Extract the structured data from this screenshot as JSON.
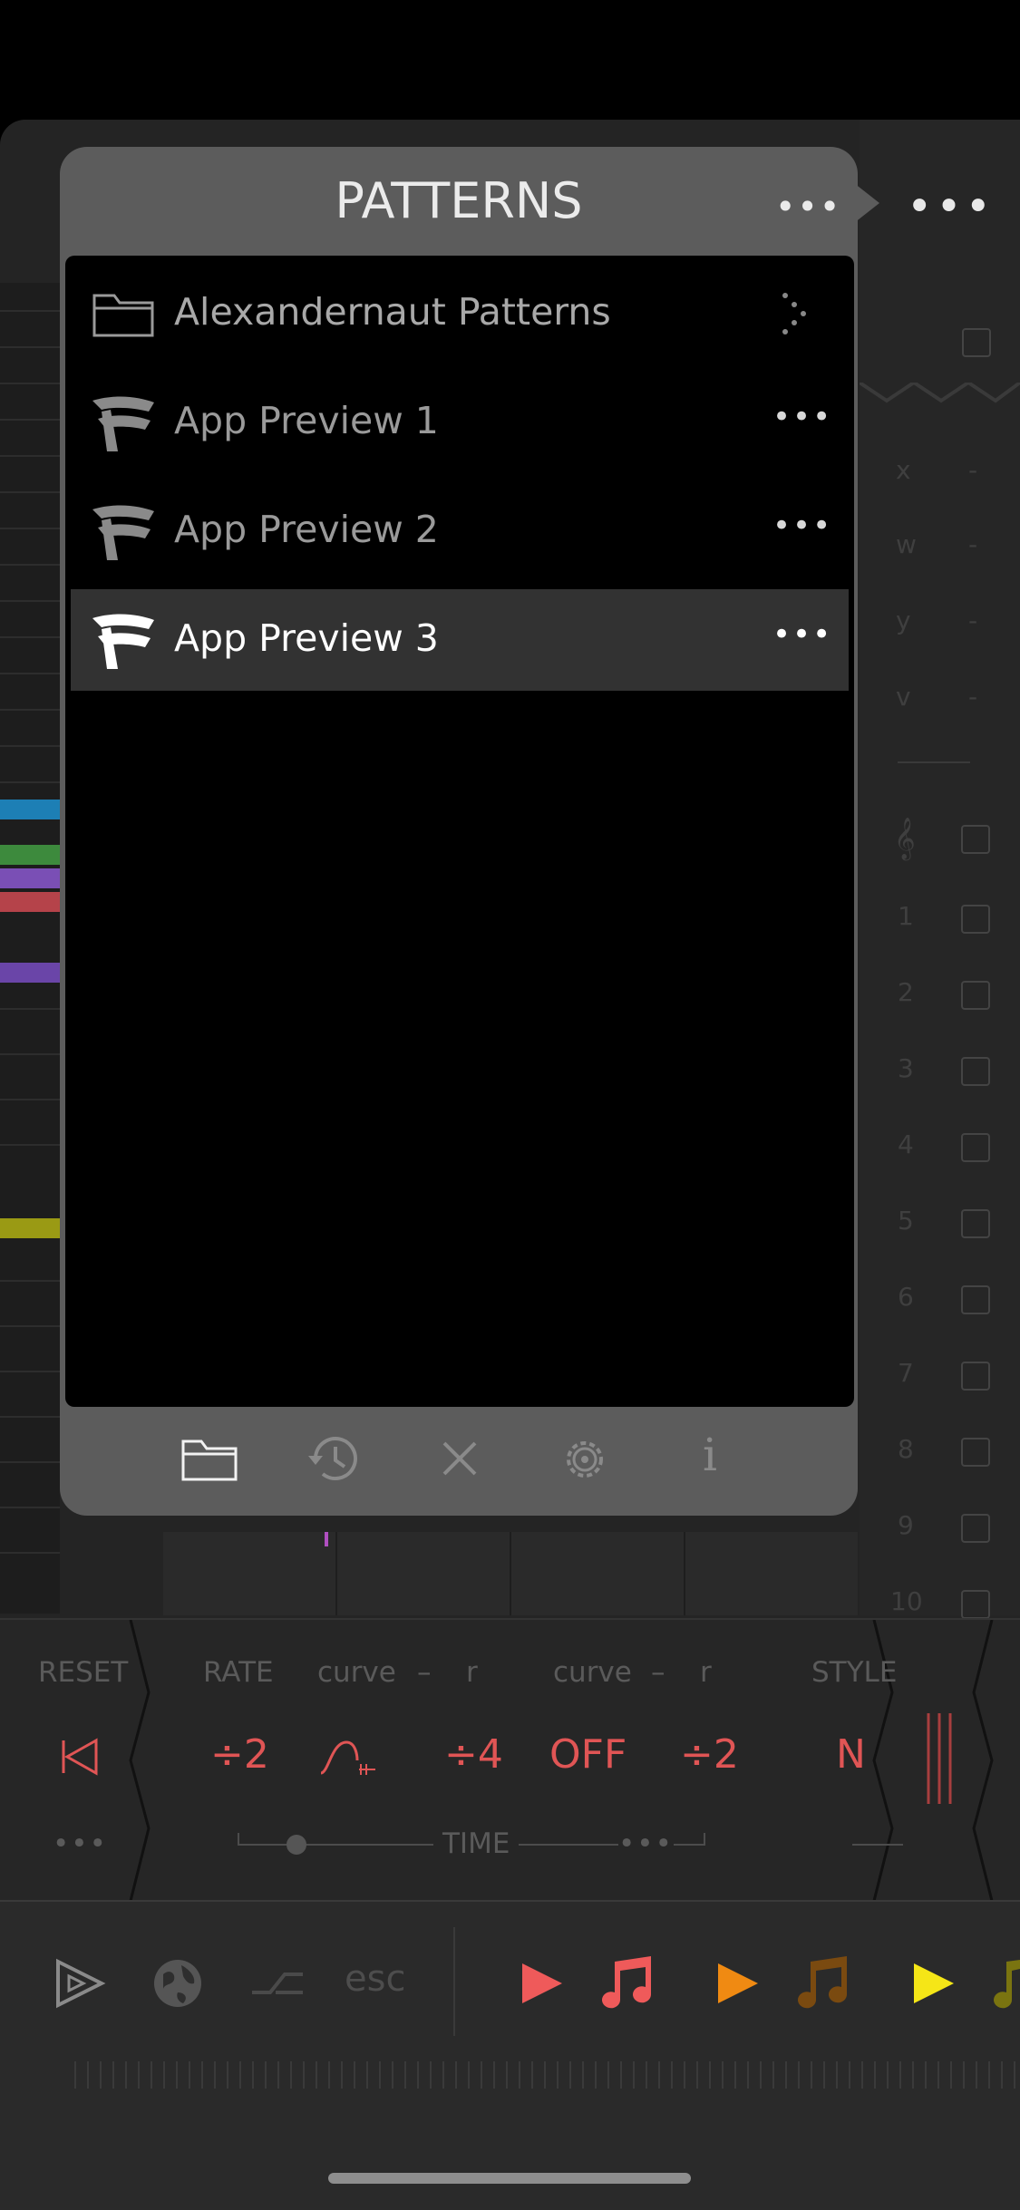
{
  "popup": {
    "title": "PATTERNS",
    "more_label": "•••",
    "items": [
      {
        "label": "Alexandernaut Patterns",
        "icon": "folder-icon",
        "action_icon": "chevron-right-icon"
      },
      {
        "label": "App Preview 1",
        "icon": "pattern-logo-icon",
        "more": "•••"
      },
      {
        "label": "App Preview 2",
        "icon": "pattern-logo-icon",
        "more": "•••"
      },
      {
        "label": "App Preview 3",
        "icon": "pattern-logo-icon",
        "more": "•••",
        "selected": true
      }
    ],
    "footer_icons": [
      "folder-icon",
      "history-icon",
      "close-icon",
      "gear-icon",
      "info-icon"
    ],
    "info_label": "i"
  },
  "top_more": "•••",
  "right_panel": {
    "letters": [
      "x",
      "w",
      "y",
      "v"
    ],
    "dash": "-",
    "numbers": [
      "1",
      "2",
      "3",
      "4",
      "5",
      "6",
      "7",
      "8",
      "9",
      "10"
    ]
  },
  "controls": {
    "reset_label": "RESET",
    "rate_label": "RATE",
    "curve1_label": "curve",
    "sep1": "–",
    "r1_label": "r",
    "curve2_label": "curve",
    "sep2": "–",
    "r2_label": "r",
    "style_label": "STYLE",
    "rate_value": "÷2",
    "div4_value": "÷4",
    "off_value": "OFF",
    "div2b_value": "÷2",
    "style_value": "N",
    "time_label": "TIME",
    "dots": "•••"
  },
  "transport": {
    "esc_label": "esc"
  },
  "colors": {
    "accent_red": "#e05555",
    "play_red": "#ef5a5a",
    "play_orange": "#f08a12",
    "play_yellow": "#f5e617"
  }
}
